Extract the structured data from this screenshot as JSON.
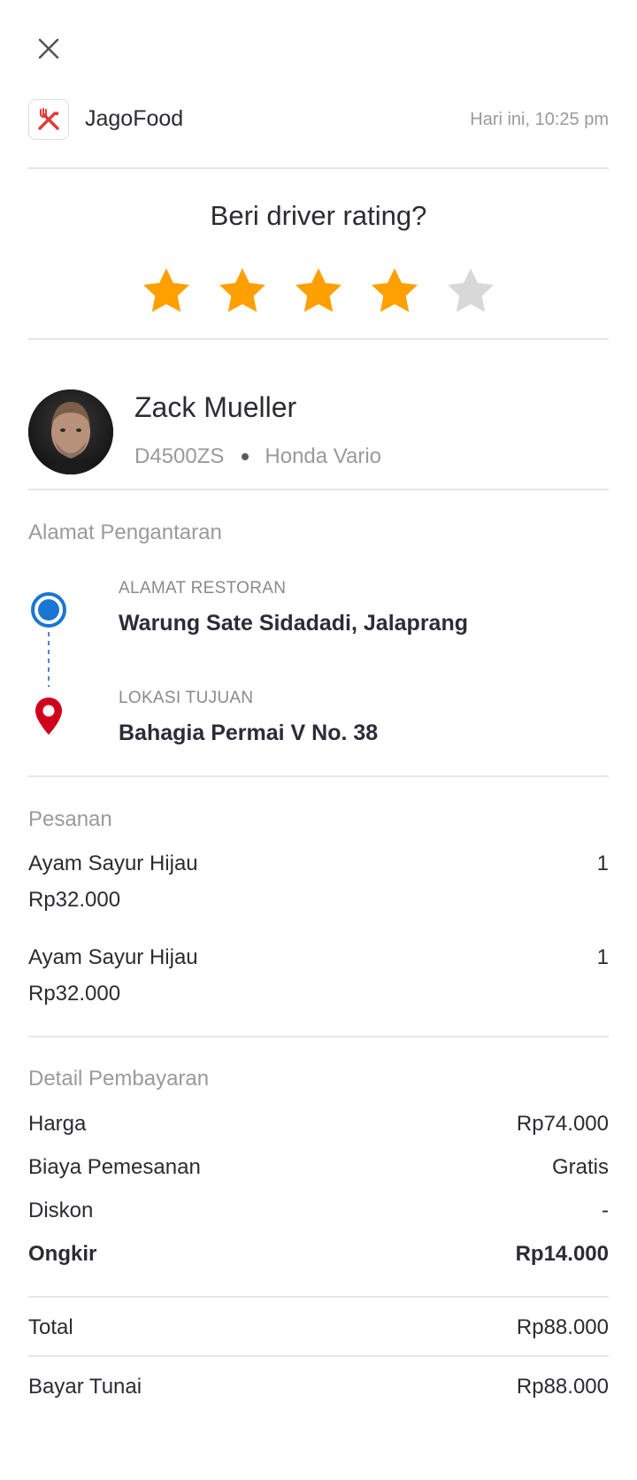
{
  "header": {
    "app_name": "JagoFood",
    "timestamp": "Hari ini, 10:25 pm",
    "icons": [
      "close-icon",
      "fork-knife-icon"
    ]
  },
  "rating": {
    "title": "Beri driver rating?",
    "value": 4,
    "max": 5,
    "star_color": "#FFA000",
    "empty_star_color": "#D8D8D8"
  },
  "driver": {
    "name": "Zack Mueller",
    "plate": "D4500ZS",
    "vehicle": "Honda Vario"
  },
  "delivery": {
    "section_label": "Alamat Pengantaran",
    "origin_label": "ALAMAT RESTORAN",
    "origin": "Warung Sate Sidadadi, Jalaprang",
    "destination_label": "LOKASI TUJUAN",
    "destination": "Bahagia Permai V No. 38",
    "origin_color": "#1976D2",
    "destination_color": "#D0021B"
  },
  "order": {
    "section_label": "Pesanan",
    "items": [
      {
        "name": "Ayam Sayur Hijau",
        "qty": "1",
        "price": "Rp32.000"
      },
      {
        "name": "Ayam Sayur Hijau",
        "qty": "1",
        "price": "Rp32.000"
      }
    ]
  },
  "payment": {
    "section_label": "Detail Pembayaran",
    "rows": [
      {
        "label": "Harga",
        "value": "Rp74.000"
      },
      {
        "label": "Biaya Pemesanan",
        "value": "Gratis"
      },
      {
        "label": "Diskon",
        "value": "-"
      },
      {
        "label": "Ongkir",
        "value": "Rp14.000"
      }
    ],
    "total_label": "Total",
    "total_value": "Rp88.000",
    "method_label": "Bayar Tunai",
    "method_value": "Rp88.000"
  }
}
